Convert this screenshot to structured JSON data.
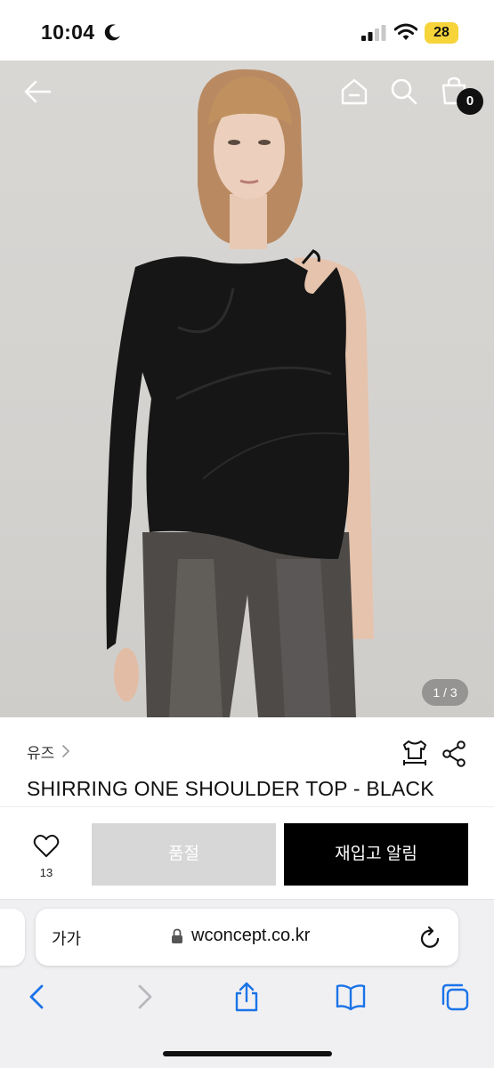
{
  "status_bar": {
    "time": "10:04",
    "battery": "28"
  },
  "hero": {
    "image_counter": "1 / 3",
    "cart_count": "0"
  },
  "product": {
    "brand": "유즈",
    "title": "SHIRRING ONE SHOULDER TOP - BLACK"
  },
  "actions": {
    "wish_count": "13",
    "soldout_label": "품절",
    "restock_label": "재입고 알림"
  },
  "browser": {
    "text_size_label": "가가",
    "url": "wconcept.co.kr"
  },
  "colors": {
    "soldout_bg": "#d7d7d7",
    "restock_bg": "#000000",
    "battery": "#f6d43a"
  },
  "icons": [
    "moon-icon",
    "signal-icon",
    "wifi-icon",
    "back-arrow-icon",
    "home-icon",
    "search-icon",
    "shopping-bag-icon",
    "size-guide-icon",
    "share-icon",
    "heart-icon",
    "lock-icon",
    "reload-icon",
    "safari-back-icon",
    "safari-forward-icon",
    "safari-share-icon",
    "bookmarks-icon",
    "tabs-icon"
  ]
}
